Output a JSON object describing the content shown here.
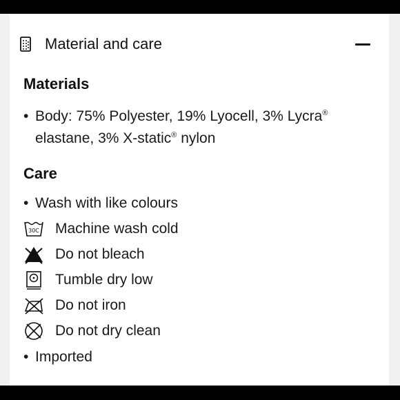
{
  "header": {
    "title": "Material and care",
    "icon": "fabric-swatch-icon",
    "toggle_icon": "minus-icon"
  },
  "materials": {
    "heading": "Materials",
    "body_line1": "Body: 75% Polyester, 19% Lyocell, 3% Lycra",
    "body_mark1": "®",
    "body_line2a": "elastane, 3% X-static",
    "body_mark2": "®",
    "body_line2b": " nylon"
  },
  "care": {
    "heading": "Care",
    "wash_with_like": "Wash with like colours",
    "items": [
      {
        "label": "Machine wash cold",
        "icon": "wash-30c-icon",
        "icon_text": "30C"
      },
      {
        "label": "Do not bleach",
        "icon": "no-bleach-icon"
      },
      {
        "label": "Tumble dry low",
        "icon": "tumble-dry-low-icon"
      },
      {
        "label": "Do not iron",
        "icon": "no-iron-icon"
      },
      {
        "label": "Do not dry clean",
        "icon": "no-dry-clean-icon"
      }
    ],
    "imported": "Imported"
  },
  "bullet": "•",
  "colors": {
    "background": "#000000",
    "panel": "#ffffff",
    "text": "#111111"
  }
}
